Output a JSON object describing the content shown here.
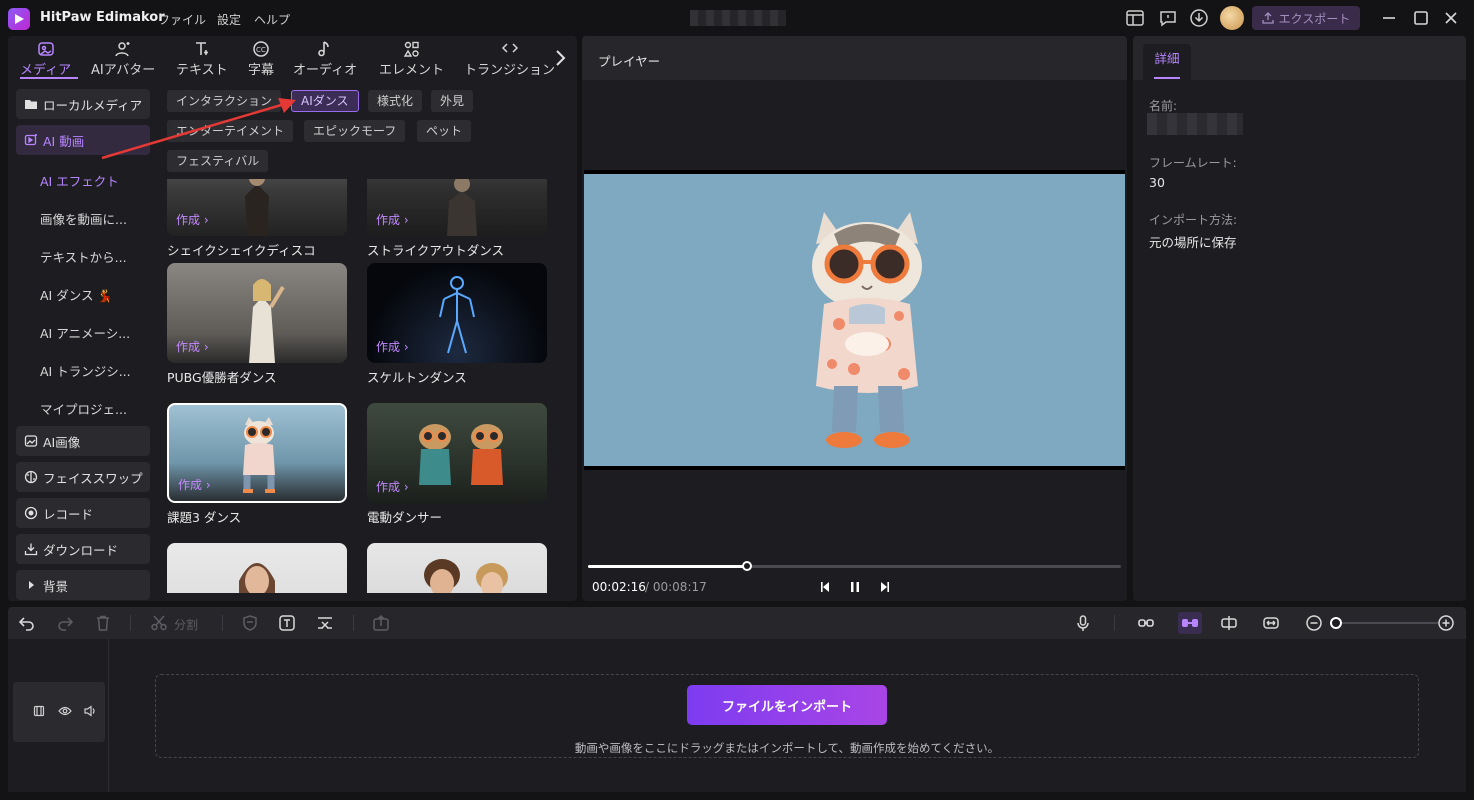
{
  "app": {
    "title": "HitPaw Edimakor",
    "menu": [
      "ファイル",
      "設定",
      "ヘルプ"
    ],
    "export_label": "エクスポート",
    "accent": "#b685ff"
  },
  "media_tabs": [
    {
      "label": "メディア",
      "icon": "media-icon"
    },
    {
      "label": "AIアバター",
      "icon": "ai-avatar-icon"
    },
    {
      "label": "テキスト",
      "icon": "text-icon"
    },
    {
      "label": "字幕",
      "icon": "subtitle-icon"
    },
    {
      "label": "オーディオ",
      "icon": "audio-icon"
    },
    {
      "label": "エレメント",
      "icon": "element-icon"
    },
    {
      "label": "トランジション",
      "icon": "transition-icon"
    }
  ],
  "sidebar": {
    "local_media": "ローカルメディア",
    "ai_video": "AI 動画",
    "sub_items": [
      "AI エフェクト",
      "画像を動画に...",
      "テキストから...",
      "AI ダンス 💃",
      "AI アニメーシ...",
      "AI トランジシ...",
      "マイプロジェ..."
    ],
    "ai_image": "AI画像",
    "face_swap": "フェイススワップ",
    "record": "レコード",
    "download": "ダウンロード",
    "background": "背景"
  },
  "categories": [
    "インタラクション",
    "AIダンス",
    "様式化",
    "外見",
    "エンターテイメント",
    "エピックモーフ",
    "ペット",
    "フェスティバル"
  ],
  "create_label": "作成 ›",
  "cards": [
    "シェイクシェイクディスコ",
    "ストライクアウトダンス",
    "PUBG優勝者ダンス",
    "スケルトンダンス",
    "課題3 ダンス",
    "電動ダンサー"
  ],
  "player": {
    "title": "プレイヤー",
    "time_current": "00:02:16",
    "time_total": "/ 00:08:17",
    "progress": 0.299
  },
  "details": {
    "tab": "詳細",
    "name_label": "名前:",
    "framerate_label": "フレームレート:",
    "framerate_value": "30",
    "import_label": "インポート方法:",
    "import_value": "元の場所に保存"
  },
  "timeline": {
    "split_label": "分割",
    "import_button": "ファイルをインポート",
    "drop_hint": "動画や画像をここにドラッグまたはインポートして、動画作成を始めてください。",
    "zoom": 0.0
  }
}
